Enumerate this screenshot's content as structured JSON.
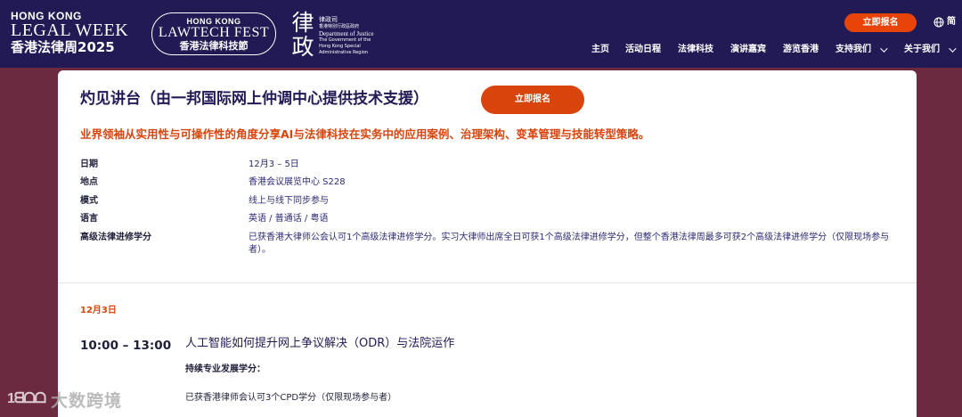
{
  "header": {
    "logo_hklw": {
      "line1": "HONG KONG",
      "line2": "LEGAL WEEK",
      "line3": "香港法律周2025"
    },
    "logo_fest": {
      "line1": "HONG KONG",
      "line2": "LAWTECH FEST",
      "line3": "香港法律科技節"
    },
    "logo_doj": {
      "mark": "律政",
      "line1": "律政司",
      "line2": "香港特別行政區政府",
      "line3": "Department of Justice",
      "line4": "The Government of the Hong Kong Special Administrative Region"
    },
    "register_label": "立即报名",
    "lang_label": "简",
    "nav": [
      {
        "label": "主页",
        "has_menu": false
      },
      {
        "label": "活动日程",
        "has_menu": false
      },
      {
        "label": "法律科技",
        "has_menu": false
      },
      {
        "label": "演讲嘉宾",
        "has_menu": false
      },
      {
        "label": "游览香港",
        "has_menu": false
      },
      {
        "label": "支持我们",
        "has_menu": true
      },
      {
        "label": "关于我们",
        "has_menu": true
      }
    ]
  },
  "event": {
    "title": "灼见讲台（由一邦国际网上仲调中心提供技术支援）",
    "register_label": "立即报名",
    "subtitle": "业界领袖从实用性与可操作性的角度分享AI与法律科技在实务中的应用案例、治理架构、变革管理与技能转型策略。",
    "info": [
      {
        "label": "日期",
        "value": "12月3 – 5日"
      },
      {
        "label": "地点",
        "value": "香港会议展览中心 S228"
      },
      {
        "label": "模式",
        "value": "线上与线下同步参与"
      },
      {
        "label": "语言",
        "value": "英语 / 普通话 / 粤语"
      },
      {
        "label": "高级法律进修学分",
        "value": "已获香港大律师公会认可1个高级法律进修学分。实习大律师出席全日可获1个高级法律进修学分，但整个香港法律周最多可获2个高级法律进修学分（仅限现场参与者）。"
      }
    ]
  },
  "schedule": {
    "date": "12月3日",
    "sessions": [
      {
        "time": "10:00 – 13:00",
        "title": "人工智能如何提升网上争议解决（ODR）与法院运作",
        "cpd_label": "持续专业发展学分：",
        "cpd_value": "已获香港律师会认可3个CPD学分（仅限现场参与者）"
      }
    ]
  },
  "watermark": {
    "mark": "1ᗺᗝᗝ",
    "text": "大数跨境"
  },
  "colors": {
    "header_bg": "#221a55",
    "page_bg": "#6b2a3f",
    "accent": "#d9430c",
    "title": "#221a55"
  },
  "icons": {
    "lang": "globe-icon",
    "menu": "chevron-down-icon"
  }
}
